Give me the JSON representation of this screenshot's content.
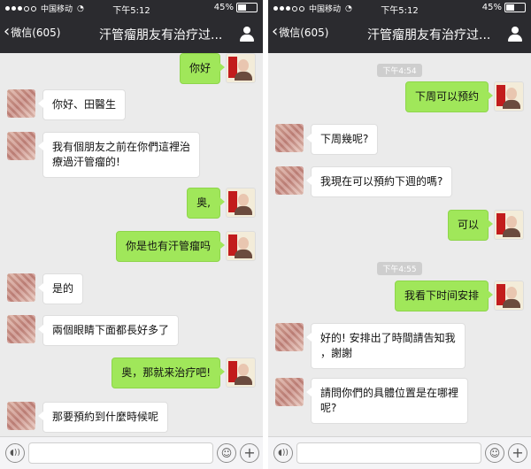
{
  "phones": [
    {
      "status": {
        "carrier": "中国移动",
        "time": "下午5:12",
        "battery": "45%",
        "battery_level": 0.45
      },
      "nav": {
        "back_label": "微信(605)",
        "title": "汗管瘤朋友有治疗过..."
      },
      "input": {
        "placeholder": ""
      },
      "messages": [
        {
          "from": "self",
          "text": "你好"
        },
        {
          "from": "other",
          "text": "你好、田醫生"
        },
        {
          "from": "other",
          "text": "我有個朋友之前在你們這裡治\n療過汗管瘤的!"
        },
        {
          "from": "self",
          "text": "奥,"
        },
        {
          "from": "self",
          "text": "你是也有汗管瘤吗"
        },
        {
          "from": "other",
          "text": "是的"
        },
        {
          "from": "other",
          "text": "兩個眼睛下面都長好多了"
        },
        {
          "from": "self",
          "text": "奥，那就来治疗吧!"
        },
        {
          "from": "other",
          "text": "那要預約到什麼時候呢"
        }
      ]
    },
    {
      "status": {
        "carrier": "中国移动",
        "time": "下午5:12",
        "battery": "45%",
        "battery_level": 0.45
      },
      "nav": {
        "back_label": "微信(605)",
        "title": "汗管瘤朋友有治疗过..."
      },
      "input": {
        "placeholder": ""
      },
      "timestamps": [
        "下午4:54",
        "下午4:55"
      ],
      "messages": [
        {
          "from": "self",
          "text": "下周可以预约"
        },
        {
          "from": "other",
          "text": "下周幾呢?"
        },
        {
          "from": "other",
          "text": "我現在可以預約下週的嗎?"
        },
        {
          "from": "self",
          "text": "可以"
        },
        {
          "from": "self",
          "text": "我看下时间安排"
        },
        {
          "from": "other",
          "text": "好的! 安排出了時間請告知我\n，謝謝"
        },
        {
          "from": "other",
          "text": "請問你們的具體位置是在哪裡\n呢?"
        }
      ]
    }
  ]
}
